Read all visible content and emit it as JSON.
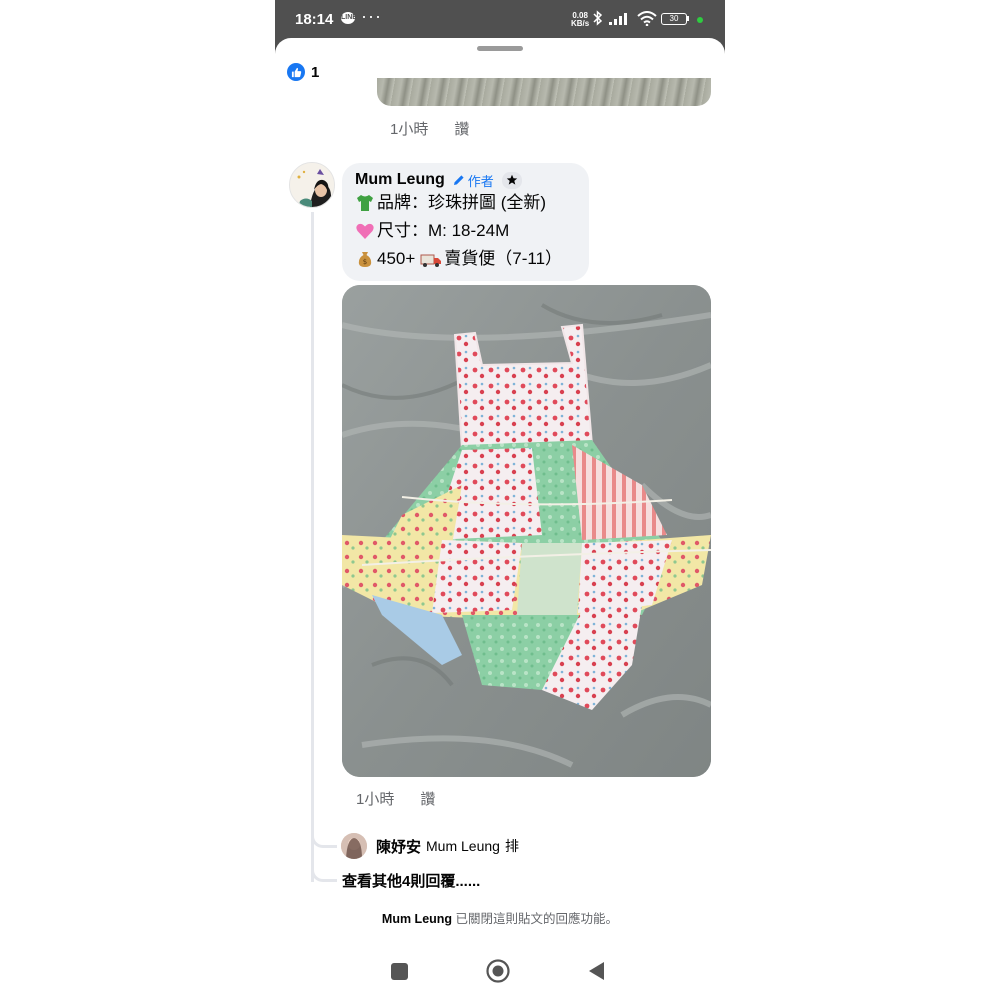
{
  "status_bar": {
    "time": "18:14",
    "notification_app": "LINE",
    "more_indicator": "···",
    "network_speed": "0.08",
    "network_unit": "KB/s",
    "battery_level": "30",
    "icons": [
      "bluetooth-icon",
      "signal-icon",
      "wifi-icon",
      "battery-icon"
    ]
  },
  "reactions": {
    "like_count": "1"
  },
  "previous_comment": {
    "time": "1小時",
    "like_action": "讚"
  },
  "comment": {
    "author": "Mum Leung",
    "author_badge": "作者",
    "lines": [
      {
        "icon": "tshirt-emoji",
        "text": "品牌：珍珠拼圖 (全新)"
      },
      {
        "icon": "pink-heart-emoji",
        "text": "尺寸：M: 18-24M"
      },
      {
        "icon": "money-bag-emoji",
        "text": "450+"
      },
      {
        "icon": "delivery-truck-emoji",
        "text": "賣貨便（7-11）"
      }
    ],
    "photo": "patchwork strawberry-print baby dress with bloomers on grey bedsheet",
    "time": "1小時",
    "like_action": "讚"
  },
  "reply": {
    "author": "陳妤安",
    "mention": "Mum Leung",
    "text": "排"
  },
  "more_replies": "查看其他4則回覆......",
  "closed_note": {
    "author": "Mum Leung",
    "text": "已關閉這則貼文的回應功能。"
  },
  "colors": {
    "link_blue": "#1877f2",
    "meta_gray": "#65676b",
    "bubble_bg": "#f0f2f5"
  }
}
